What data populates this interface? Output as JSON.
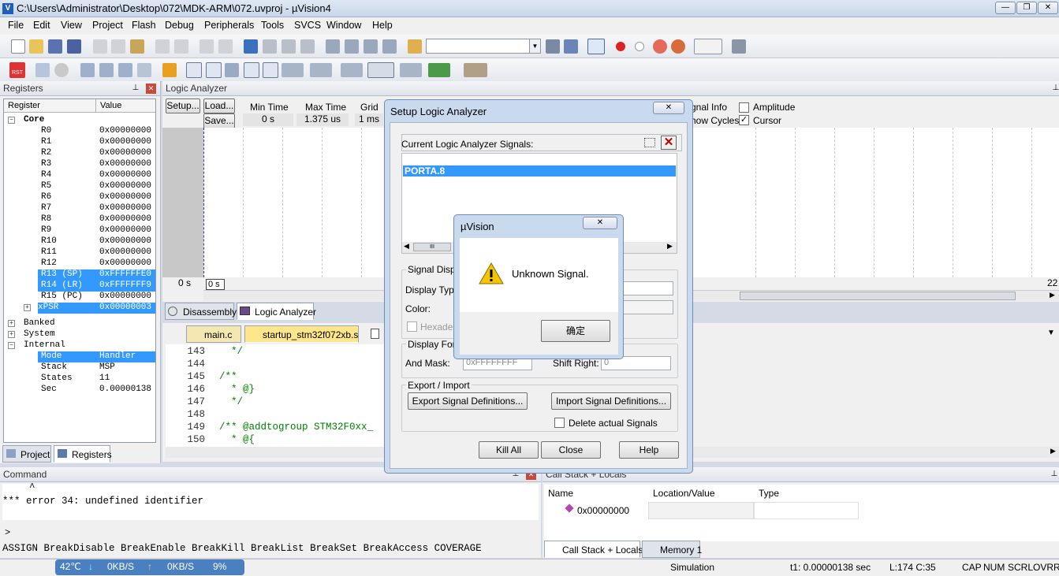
{
  "window": {
    "title": "C:\\Users\\Administrator\\Desktop\\072\\MDK-ARM\\072.uvproj - µVision4",
    "icon": "app-icon",
    "controls": [
      "—",
      "❐",
      "✕"
    ]
  },
  "menu": [
    "File",
    "Edit",
    "View",
    "Project",
    "Flash",
    "Debug",
    "Peripherals",
    "Tools",
    "SVCS",
    "Window",
    "Help"
  ],
  "registers_panel": {
    "title": "Registers",
    "columns": [
      "Register",
      "Value"
    ],
    "core_label": "Core",
    "rows": [
      {
        "name": "R0",
        "value": "0x00000000"
      },
      {
        "name": "R1",
        "value": "0x00000000"
      },
      {
        "name": "R2",
        "value": "0x00000000"
      },
      {
        "name": "R3",
        "value": "0x00000000"
      },
      {
        "name": "R4",
        "value": "0x00000000"
      },
      {
        "name": "R5",
        "value": "0x00000000"
      },
      {
        "name": "R6",
        "value": "0x00000000"
      },
      {
        "name": "R7",
        "value": "0x00000000"
      },
      {
        "name": "R8",
        "value": "0x00000000"
      },
      {
        "name": "R9",
        "value": "0x00000000"
      },
      {
        "name": "R10",
        "value": "0x00000000"
      },
      {
        "name": "R11",
        "value": "0x00000000"
      },
      {
        "name": "R12",
        "value": "0x00000000"
      },
      {
        "name": "R13 (SP)",
        "value": "0xFFFFFFE0"
      },
      {
        "name": "R14 (LR)",
        "value": "0xFFFFFFF9"
      },
      {
        "name": "R15 (PC)",
        "value": "0x00000000"
      },
      {
        "name": "xPSR",
        "value": "0x00000003"
      }
    ],
    "groups": [
      "Banked",
      "System",
      "Internal"
    ],
    "internal": [
      {
        "name": "Mode",
        "value": "Handler"
      },
      {
        "name": "Stack",
        "value": "MSP"
      },
      {
        "name": "States",
        "value": "11"
      },
      {
        "name": "Sec",
        "value": "0.00000138"
      }
    ],
    "tabs": [
      "Project",
      "Registers"
    ]
  },
  "logic_analyzer": {
    "title": "Logic Analyzer",
    "setup": "Setup...",
    "load": "Load...",
    "save": "Save...",
    "min_time_label": "Min Time",
    "min_time": "0 s",
    "max_time_label": "Max Time",
    "max_time": "1.375 us",
    "grid_label": "Grid",
    "grid": "1 ms",
    "signal_info": "gnal Info",
    "show_cycles": "how Cycles",
    "amplitude": "Amplitude",
    "cursor": "Cursor",
    "time_left": "0 s",
    "time_box": "0 s",
    "time_right": "22",
    "tabs": [
      "Disassembly",
      "Logic Analyzer"
    ]
  },
  "editor": {
    "tabs": [
      "main.c",
      "startup_stm32f072xb.s"
    ],
    "lines": [
      {
        "n": "143",
        "t": "  */"
      },
      {
        "n": "144",
        "t": ""
      },
      {
        "n": "145",
        "t": "/**"
      },
      {
        "n": "146",
        "t": "  * @}"
      },
      {
        "n": "147",
        "t": "  */"
      },
      {
        "n": "148",
        "t": ""
      },
      {
        "n": "149",
        "t": "/** @addtogroup STM32F0xx_"
      },
      {
        "n": "150",
        "t": "  * @{"
      }
    ]
  },
  "setup_dialog": {
    "title": "Setup Logic Analyzer",
    "current_label": "Current Logic Analyzer Signals:",
    "signal": "PORTA.8",
    "scroll_mark": "III",
    "signal_display": "Signal Displa",
    "display_type": "Display Type",
    "color": "Color:",
    "hexadecimal": "Hexadec",
    "display_formula": "Display Form",
    "and_mask": "And Mask:",
    "and_mask_value": "0xFFFFFFFF",
    "shift_right": "Shift Right:",
    "shift_right_value": "0",
    "export_import": "Export / Import",
    "export_btn": "Export Signal Definitions...",
    "import_btn": "Import Signal Definitions...",
    "delete_label": "Delete actual Signals",
    "kill_all": "Kill All",
    "close": "Close",
    "help": "Help"
  },
  "alert": {
    "title": "µVision",
    "message": "Unknown Signal.",
    "ok": "确定"
  },
  "command": {
    "title": "Command",
    "caret": "^",
    "error": "*** error 34: undefined identifier",
    "prompt": ">",
    "hint": "ASSIGN BreakDisable BreakEnable BreakKill BreakList BreakSet BreakAccess COVERAGE"
  },
  "callstack": {
    "title": "Call Stack + Locals",
    "columns": [
      "Name",
      "Location/Value",
      "Type"
    ],
    "row": "0x00000000",
    "tabs": [
      "Call Stack + Locals",
      "Memory 1"
    ]
  },
  "statusbar": {
    "temp": "42℃",
    "down": "0KB/S",
    "up": "0KB/S",
    "cpu": "9%",
    "simulation": "Simulation",
    "t1": "t1: 0.00000138 sec",
    "pos": "L:174 C:35",
    "caps": "CAP",
    "num": "NUM",
    "scrl": "SCRL",
    "ovr": "OVR",
    "rw": "R"
  },
  "colors": {
    "selection": "#3399ff",
    "accent": "#1f5fb7"
  }
}
